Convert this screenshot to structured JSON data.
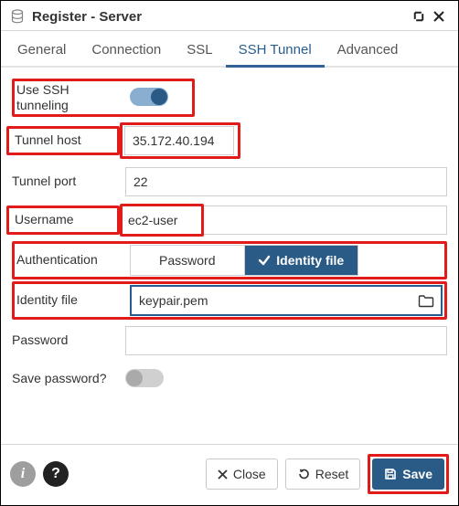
{
  "dialog": {
    "title": "Register - Server"
  },
  "tabs": [
    {
      "id": "general",
      "label": "General",
      "active": false
    },
    {
      "id": "connection",
      "label": "Connection",
      "active": false
    },
    {
      "id": "ssl",
      "label": "SSL",
      "active": false
    },
    {
      "id": "ssh",
      "label": "SSH Tunnel",
      "active": true
    },
    {
      "id": "advanced",
      "label": "Advanced",
      "active": false
    }
  ],
  "ssh": {
    "use_tunneling_label": "Use SSH tunneling",
    "use_tunneling": true,
    "host_label": "Tunnel host",
    "host": "35.172.40.194",
    "port_label": "Tunnel port",
    "port": "22",
    "username_label": "Username",
    "username": "ec2-user",
    "auth_label": "Authentication",
    "auth_options": {
      "password": "Password",
      "identity": "Identity file"
    },
    "auth_selected": "identity",
    "identity_label": "Identity file",
    "identity_file": "keypair.pem",
    "password_label": "Password",
    "password": "",
    "save_password_label": "Save password?",
    "save_password": false
  },
  "footer": {
    "close_label": "Close",
    "reset_label": "Reset",
    "save_label": "Save"
  }
}
